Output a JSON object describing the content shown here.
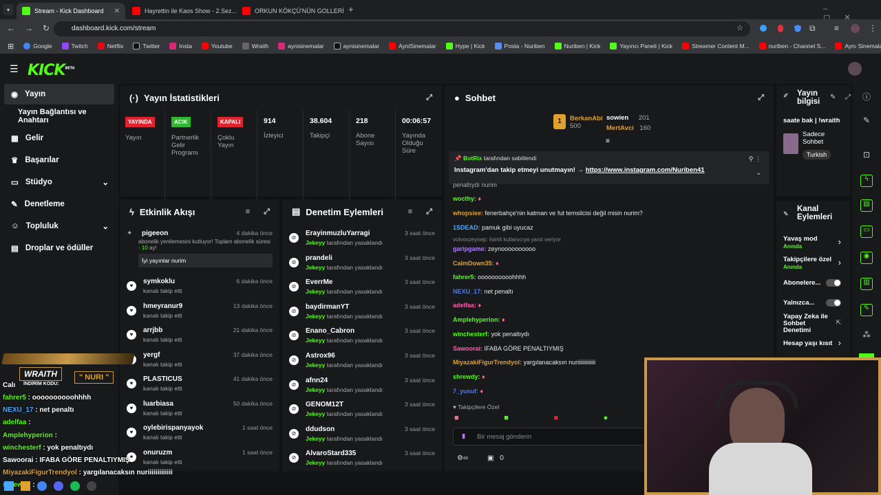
{
  "browser": {
    "tabs": [
      {
        "label": "Stream - Kick Dashboard"
      },
      {
        "label": "Hayrettin ile Kaos Show - 2.Sez..."
      },
      {
        "label": "ORKUN KÖKÇÜ'NÜN GOLLERİN..."
      }
    ],
    "url": "dashboard.kick.com/stream"
  },
  "bookmarks": [
    "Google",
    "Twitch",
    "Netflix",
    "Twitter",
    "Insta",
    "Youtube",
    "Wraith",
    "aynisinemalar",
    "aynisinemalar",
    "AyniSinemalar",
    "Hype | Kick",
    "Posta - Nuriben",
    "Nuriben | Kick",
    "Yayıncı Paneli | Kick",
    "Streamer Content M...",
    "nuriben - Channel S...",
    "Aynı Sinemalar - Ça..."
  ],
  "brand": {
    "logo": "KICK",
    "beta": "BETA"
  },
  "sidebar": {
    "items": [
      {
        "label": "Yayın"
      },
      {
        "label": "Yayın Bağlantısı ve Anahtarı"
      },
      {
        "label": "Gelir"
      },
      {
        "label": "Başarılar"
      },
      {
        "label": "Stüdyo"
      },
      {
        "label": "Denetleme"
      },
      {
        "label": "Topluluk"
      },
      {
        "label": "Droplar ve ödüller"
      }
    ]
  },
  "stats": {
    "title": "Yayın İstatistikleri",
    "items": [
      {
        "badge": "YAYINDA",
        "label": "Yayın",
        "color": "#e1232f"
      },
      {
        "badge": "ACIK",
        "label": "Partnerlik Gelir Programı",
        "color": "#2fb82f"
      },
      {
        "badge": "KAPALI",
        "label": "Çoklu Yayın",
        "color": "#e1232f"
      },
      {
        "value": "914",
        "label": "İzleyici"
      },
      {
        "value": "38.604",
        "label": "Takipçi"
      },
      {
        "value": "218",
        "label": "Abone Sayısı"
      },
      {
        "value": "00:06:57",
        "label": "Yayında Olduğu Süre"
      }
    ]
  },
  "activity": {
    "title": "Etkinlik Akışı",
    "first": {
      "name": "pigeeon",
      "time": "4 dakika önce",
      "text": "abonelik yenilemesini kutluyor! Toplam abonelik süresi - ",
      "months": "10",
      "months_suffix": " ay!",
      "msg": "İyi yayınlar nurim"
    },
    "items": [
      {
        "name": "symkoklu",
        "time": "6 dakika önce"
      },
      {
        "name": "hmeyranur9",
        "time": "13 dakika önce"
      },
      {
        "name": "arrjbb",
        "time": "21 dakika önce"
      },
      {
        "name": "yergf",
        "time": "37 dakika önce"
      },
      {
        "name": "PLASTICUS",
        "time": "41 dakika önce"
      },
      {
        "name": "luarbiasa",
        "time": "50 dakika önce"
      },
      {
        "name": "oylebirispanyayok",
        "time": "1 saat önce"
      },
      {
        "name": "onuruzm",
        "time": "1 saat önce"
      }
    ],
    "follow_text": "kanalı takip etti"
  },
  "moderation": {
    "title": "Denetim Eylemleri",
    "by": "Jekeyy",
    "action": "tarafından yasaklandı",
    "items": [
      {
        "name": "ErayinmuzluYarragi",
        "time": "3 saat önce"
      },
      {
        "name": "prandeli",
        "time": "3 saat önce"
      },
      {
        "name": "EverrMe",
        "time": "3 saat önce"
      },
      {
        "name": "baydirmanYT",
        "time": "3 saat önce"
      },
      {
        "name": "Enano_Cabron",
        "time": "3 saat önce"
      },
      {
        "name": "Astrox96",
        "time": "3 saat önce"
      },
      {
        "name": "afnn24",
        "time": "3 saat önce"
      },
      {
        "name": "GENOM12T",
        "time": "3 saat önce"
      },
      {
        "name": "ddudson",
        "time": "3 saat önce"
      },
      {
        "name": "AlvaroStard335",
        "time": "3 saat önce"
      }
    ]
  },
  "chat": {
    "title": "Sohbet",
    "leaders": [
      {
        "name": "BerkanAbi",
        "count": "500"
      },
      {
        "name": "sowien",
        "count": "201"
      },
      {
        "name": "MertAvci",
        "count": "160"
      }
    ],
    "pinned": {
      "by": "BotRix",
      "label": "tarafından sabitlendi",
      "text": "Instagram'dan takip etmeyi unutmayın! → ",
      "link": "https://www.instagram.com/Nuriben41"
    },
    "messages": [
      {
        "u": "wocthy:",
        "t": "",
        "c": "#53fc18"
      },
      {
        "u": "whopsiee:",
        "t": "fenerbahçe'nin katman ve fut temsilcisi değil misin nurim?",
        "c": "#e0a030"
      },
      {
        "u": "1SDEAD:",
        "t": "pamuk gibi uyucaz",
        "c": "#4aa8ff"
      },
      {
        "u": "garipgame:",
        "t": "zeynoooooooooo",
        "c": "#b07aff"
      },
      {
        "u": "CalmDown35:",
        "t": "",
        "c": "#e0a030"
      },
      {
        "u": "fahrer5:",
        "t": "oooooooooohhhh",
        "c": "#53fc18"
      },
      {
        "u": "NEXU_17:",
        "t": "net penaltı",
        "c": "#4a7aff"
      },
      {
        "u": "adelfaa:",
        "t": "",
        "c": "#ff5cae"
      },
      {
        "u": "Amplehyperion:",
        "t": "",
        "c": "#53fc18"
      },
      {
        "u": "winchesterf:",
        "t": "yok penaltıydı",
        "c": "#53fc18"
      },
      {
        "u": "Sawoorai:",
        "t": "IFABA GÖRE PENALTIYMIŞ",
        "c": "#ff5cae"
      },
      {
        "u": "MiyazakiFigurTrendyol:",
        "t": "yargılanacaksın nuriiiiiiiiiiiii",
        "c": "#e0a030"
      },
      {
        "u": "shrewdy:",
        "t": "",
        "c": "#53fc18"
      },
      {
        "u": "7_yusuf:",
        "t": "",
        "c": "#4a7aff"
      }
    ],
    "reply_note": "volvoxzeynep: İsimli kullanıcıya yanıt veriyor",
    "cut_line": "penaltıydı nurim",
    "followers_only": "Takipçilere Özel",
    "placeholder": "Bir mesaj gönderin",
    "points": "0"
  },
  "streaminfo": {
    "title": "Yayın bilgisi",
    "stream_title": "saate bak | !wraith",
    "category": "Sadece Sohbet",
    "language": "Turkish"
  },
  "channel_actions": {
    "title": "Kanal Eylemleri",
    "items": [
      {
        "label": "Yavaş mod",
        "sub": "Anında"
      },
      {
        "label": "Takipçilere özel",
        "sub": "Anında"
      },
      {
        "label": "Abonelere..."
      },
      {
        "label": "Yalnızca..."
      },
      {
        "label": "Yapay Zeka ile Sohbet Denetimi"
      },
      {
        "label": "Hesap yaşı kısıt"
      }
    ]
  },
  "overlay": {
    "brand": "WRAITH",
    "code_label": "İNDİRİM KODU:",
    "code": "\" NURI \"",
    "cut_name": "Calı",
    "lines": [
      {
        "u": "fahrer5",
        "t": " : oooooooooohhhh",
        "c": "#53fc18"
      },
      {
        "u": "NEXU_17",
        "t": " : net penaltı",
        "c": "#4aa8ff"
      },
      {
        "u": "adelfaa",
        "t": " :",
        "c": "#53fc18"
      },
      {
        "u": "Amplehyperion",
        "t": " :",
        "c": "#53fc18"
      },
      {
        "u": "winchesterf",
        "t": " : yok penaltıydı",
        "c": "#53fc18"
      },
      {
        "u": "Sawoorai",
        "t": " : IFABA GÖRE PENALTIYMIŞ",
        "c": "#fff"
      },
      {
        "u": "MiyazakiFigurTrendyol",
        "t": " : yargılanacaksın nuriiiiiiiiiiiii",
        "c": "#e0a030"
      },
      {
        "u": "shrewdy",
        "t": " :",
        "c": "#53fc18"
      }
    ]
  }
}
